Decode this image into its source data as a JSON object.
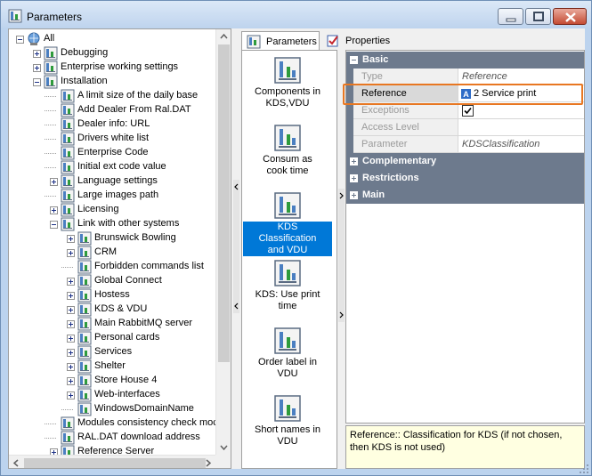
{
  "window": {
    "title": "Parameters"
  },
  "tree": {
    "items": [
      {
        "label": "All",
        "level": 0,
        "expander": "minus"
      },
      {
        "label": "Debugging",
        "level": 1,
        "expander": "plus"
      },
      {
        "label": "Enterprise working settings",
        "level": 1,
        "expander": "plus"
      },
      {
        "label": "Installation",
        "level": 1,
        "expander": "minus"
      },
      {
        "label": "A limit size of the daily base",
        "level": 2,
        "expander": "none"
      },
      {
        "label": "Add Dealer From Ral.DAT",
        "level": 2,
        "expander": "none"
      },
      {
        "label": "Dealer info: URL",
        "level": 2,
        "expander": "none"
      },
      {
        "label": "Drivers white list",
        "level": 2,
        "expander": "none"
      },
      {
        "label": "Enterprise Code",
        "level": 2,
        "expander": "none"
      },
      {
        "label": "Initial ext code value",
        "level": 2,
        "expander": "none"
      },
      {
        "label": "Language settings",
        "level": 2,
        "expander": "plus"
      },
      {
        "label": "Large images path",
        "level": 2,
        "expander": "none"
      },
      {
        "label": "Licensing",
        "level": 2,
        "expander": "plus"
      },
      {
        "label": "Link with other systems",
        "level": 2,
        "expander": "minus"
      },
      {
        "label": "Brunswick Bowling",
        "level": 3,
        "expander": "plus"
      },
      {
        "label": "CRM",
        "level": 3,
        "expander": "plus"
      },
      {
        "label": "Forbidden commands list",
        "level": 3,
        "expander": "none"
      },
      {
        "label": "Global Connect",
        "level": 3,
        "expander": "plus"
      },
      {
        "label": "Hostess",
        "level": 3,
        "expander": "plus"
      },
      {
        "label": "KDS & VDU",
        "level": 3,
        "expander": "plus"
      },
      {
        "label": "Main RabbitMQ server",
        "level": 3,
        "expander": "plus"
      },
      {
        "label": "Personal cards",
        "level": 3,
        "expander": "plus"
      },
      {
        "label": "Services",
        "level": 3,
        "expander": "plus"
      },
      {
        "label": "Shelter",
        "level": 3,
        "expander": "plus"
      },
      {
        "label": "Store House 4",
        "level": 3,
        "expander": "plus"
      },
      {
        "label": "Web-interfaces",
        "level": 3,
        "expander": "plus"
      },
      {
        "label": "WindowsDomainName",
        "level": 3,
        "expander": "none"
      },
      {
        "label": "Modules consistency check moc",
        "level": 2,
        "expander": "none"
      },
      {
        "label": "RAL.DAT download address",
        "level": 2,
        "expander": "none"
      },
      {
        "label": "Reference Server",
        "level": 2,
        "expander": "plus"
      }
    ]
  },
  "tabs": [
    {
      "label": "Parameters",
      "icon": "parameters-icon",
      "active": true
    },
    {
      "label": "Properties",
      "icon": "properties-icon",
      "active": false
    }
  ],
  "icon_list": [
    {
      "label": "Components in KDS,VDU",
      "lines": [
        "Components in",
        "KDS,VDU"
      ],
      "selected": false
    },
    {
      "label": "Consum as cook time",
      "lines": [
        "Consum as",
        "cook time"
      ],
      "selected": false
    },
    {
      "label": "KDS Classification and VDU",
      "lines": [
        "KDS",
        "Classification",
        "and VDU"
      ],
      "selected": true
    },
    {
      "label": "KDS: Use print time",
      "lines": [
        "KDS: Use print",
        "time"
      ],
      "selected": false
    },
    {
      "label": "Order label in VDU",
      "lines": [
        "Order label in",
        "VDU"
      ],
      "selected": false
    },
    {
      "label": "Short names in VDU",
      "lines": [
        "Short names in",
        "VDU"
      ],
      "selected": false
    }
  ],
  "property_grid": {
    "categories": [
      {
        "label": "Basic",
        "expanded": true
      },
      {
        "label": "Complementary",
        "expanded": false
      },
      {
        "label": "Restrictions",
        "expanded": false
      },
      {
        "label": "Main",
        "expanded": false
      }
    ],
    "rows": [
      {
        "name": "Type",
        "value": "Reference",
        "style": "italic"
      },
      {
        "name": "Reference",
        "value": "2 Service print",
        "style": "normal",
        "value_icon": "reference-letter-a-icon"
      },
      {
        "name": "Exceptions",
        "value": "",
        "style": "checkbox",
        "checked": true
      },
      {
        "name": "Access Level",
        "value": "",
        "style": "normal"
      },
      {
        "name": "Parameter",
        "value": "KDSClassification",
        "style": "italic"
      }
    ],
    "value_icon_letter": "A"
  },
  "description": "Reference:: Classification for KDS (if not chosen, then KDS is not used)",
  "colors": {
    "highlight": "#e87722",
    "selection": "#0078d7",
    "category_bg": "#6d7a8d",
    "description_bg": "#ffffe1"
  }
}
